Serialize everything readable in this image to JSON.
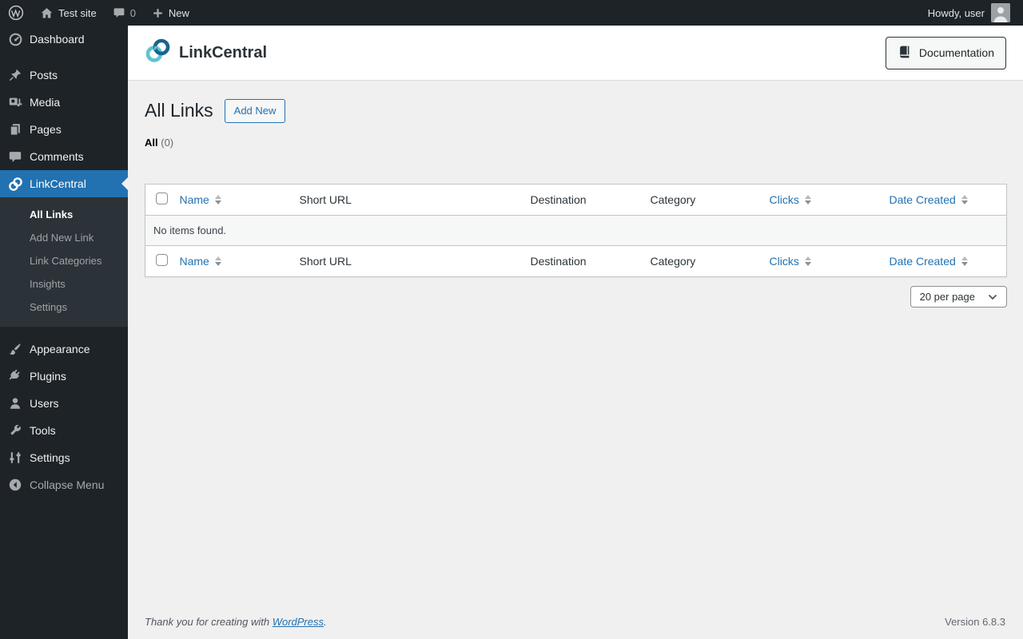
{
  "admin_bar": {
    "site_name": "Test site",
    "comments_count": "0",
    "new_label": "New",
    "howdy": "Howdy, user"
  },
  "sidebar": {
    "items": [
      {
        "label": "Dashboard"
      },
      {
        "label": "Posts"
      },
      {
        "label": "Media"
      },
      {
        "label": "Pages"
      },
      {
        "label": "Comments"
      },
      {
        "label": "LinkCentral",
        "active": true
      },
      {
        "label": "Appearance"
      },
      {
        "label": "Plugins"
      },
      {
        "label": "Users"
      },
      {
        "label": "Tools"
      },
      {
        "label": "Settings"
      },
      {
        "label": "Collapse Menu"
      }
    ],
    "submenu": [
      {
        "label": "All Links",
        "active": true
      },
      {
        "label": "Add New Link"
      },
      {
        "label": "Link Categories"
      },
      {
        "label": "Insights"
      },
      {
        "label": "Settings"
      }
    ]
  },
  "plugin_header": {
    "title": "LinkCentral",
    "documentation_label": "Documentation"
  },
  "main": {
    "page_title": "All Links",
    "add_new_label": "Add New",
    "filter": {
      "all_label": "All",
      "all_count": "(0)"
    },
    "no_items": "No items found.",
    "per_page": "20 per page",
    "table": {
      "columns": [
        {
          "label": "Name",
          "sortable": true
        },
        {
          "label": "Short URL",
          "sortable": false
        },
        {
          "label": "Destination",
          "sortable": false
        },
        {
          "label": "Category",
          "sortable": false
        },
        {
          "label": "Clicks",
          "sortable": true
        },
        {
          "label": "Date Created",
          "sortable": true
        }
      ]
    }
  },
  "footer": {
    "thanks_prefix": "Thank you for creating with ",
    "wordpress_link": "WordPress",
    "thanks_suffix": ".",
    "version": "Version 6.8.3"
  },
  "colors": {
    "accent_blue": "#2271b1",
    "admin_dark": "#1d2327",
    "submenu_dark": "#2c3338",
    "content_bg": "#f0f0f1",
    "logo_teal": "#5fc4cf",
    "logo_blue": "#19648c"
  },
  "icons": {
    "wordpress-logo-icon": "ring with W",
    "home-icon": "house",
    "comments-bubble-icon": "speech bubble",
    "plus-icon": "plus",
    "avatar": "person silhouette",
    "linkcentral-logo-icon": "two interlocked rings",
    "book-icon": "closed book",
    "chevron-down-icon": "v",
    "sort-arrows-icon": "up/down triangles"
  }
}
